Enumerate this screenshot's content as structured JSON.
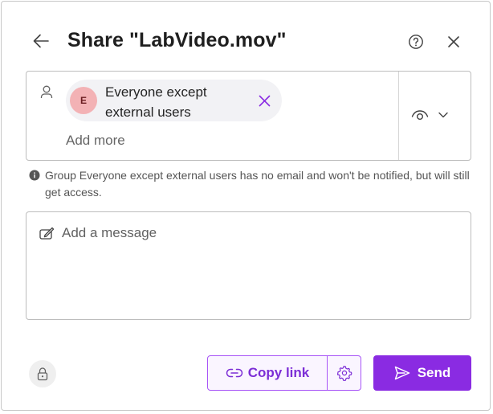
{
  "dialog": {
    "title": "Share \"LabVideo.mov\"",
    "icons": {
      "back": "arrow-left-icon",
      "help": "question-circle-icon",
      "close": "close-icon"
    }
  },
  "recipients": {
    "chips": [
      {
        "initial": "E",
        "name": "Everyone except external users"
      }
    ],
    "add_more_placeholder": "Add more",
    "permission_icon": "eye-icon"
  },
  "notice": {
    "text": "Group Everyone except external users has no email and won't be notified, but will still get access."
  },
  "message": {
    "placeholder": "Add a message",
    "value": ""
  },
  "footer": {
    "copy_link_label": "Copy link",
    "send_label": "Send"
  },
  "colors": {
    "accent": "#8a2be2",
    "accent_text": "#7c2ed6",
    "avatar_bg": "#f3b2b5"
  }
}
